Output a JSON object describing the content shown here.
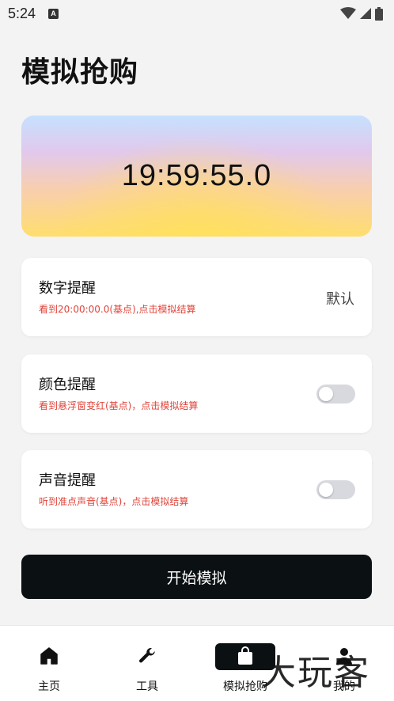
{
  "status_bar": {
    "time": "5:24",
    "app_icon": "A"
  },
  "page": {
    "title": "模拟抢购"
  },
  "timer": {
    "value": "19:59:55.0"
  },
  "cards": [
    {
      "title": "数字提醒",
      "subtitle": "看到20:00:00.0(基点),点击模拟结算",
      "value": "默认"
    },
    {
      "title": "颜色提醒",
      "subtitle": "看到悬浮窗变红(基点)，点击模拟结算",
      "toggle_on": false
    },
    {
      "title": "声音提醒",
      "subtitle": "听到准点声音(基点)，点击模拟结算",
      "toggle_on": false
    }
  ],
  "start_button": {
    "label": "开始模拟"
  },
  "bottom_nav": [
    {
      "label": "主页",
      "icon": "home-icon",
      "active": false
    },
    {
      "label": "工具",
      "icon": "wrench-icon",
      "active": false
    },
    {
      "label": "模拟抢购",
      "icon": "shopping-bag-icon",
      "active": true
    },
    {
      "label": "我的",
      "icon": "user-icon",
      "active": false
    }
  ],
  "watermark": {
    "text": "大玩客"
  },
  "colors": {
    "accent_red": "#e0443a",
    "button_dark": "#0b1013",
    "toggle_off": "#d8d9de"
  }
}
